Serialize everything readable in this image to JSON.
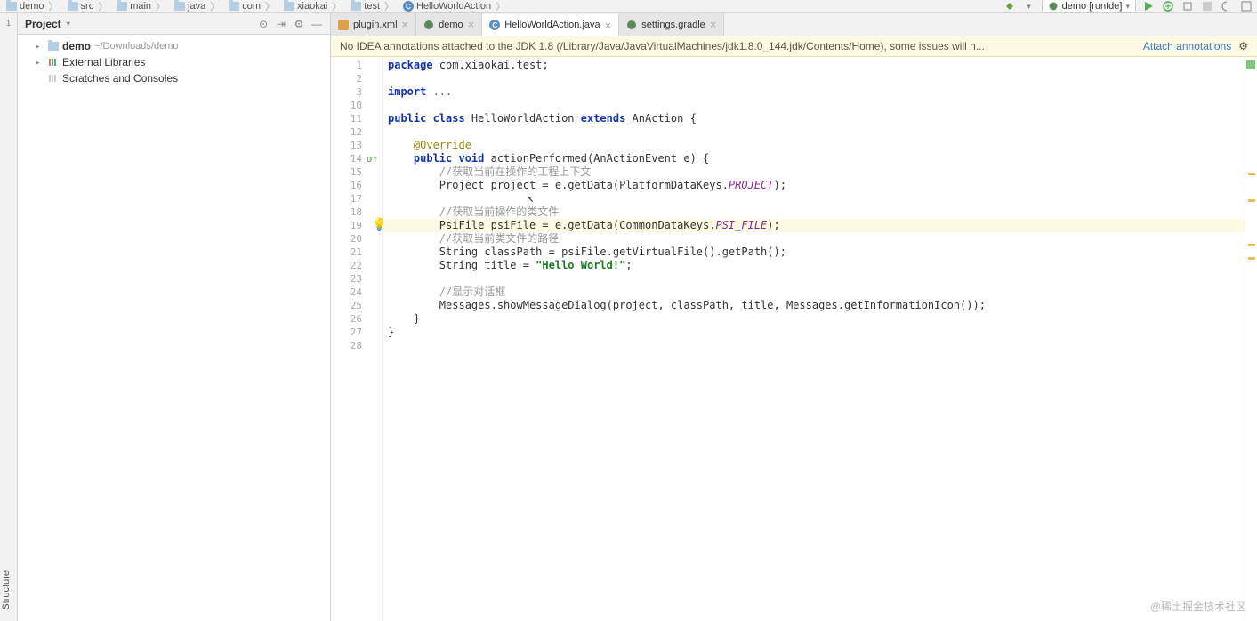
{
  "breadcrumbs": [
    "demo",
    "src",
    "main",
    "java",
    "com",
    "xiaokai",
    "test",
    "HelloWorldAction"
  ],
  "run_config": "demo [runIde]",
  "project_panel": {
    "title": "Project",
    "items": [
      {
        "label": "demo",
        "path": "~/Downloads/demo"
      },
      {
        "label": "External Libraries"
      },
      {
        "label": "Scratches and Consoles"
      }
    ]
  },
  "tabs": [
    {
      "label": "plugin.xml",
      "icon": "xml"
    },
    {
      "label": "demo",
      "icon": "gradle"
    },
    {
      "label": "HelloWorldAction.java",
      "icon": "java",
      "active": true
    },
    {
      "label": "settings.gradle",
      "icon": "gradle"
    }
  ],
  "notification": {
    "message": "No IDEA annotations attached to the JDK 1.8 (/Library/Java/JavaVirtualMachines/jdk1.8.0_144.jdk/Contents/Home), some issues will n...",
    "link": "Attach annotations"
  },
  "code": {
    "start_line": 1,
    "lines": [
      {
        "n": 1,
        "segs": [
          {
            "t": "package ",
            "c": "kw"
          },
          {
            "t": "com.xiaokai.test;"
          }
        ]
      },
      {
        "n": 2,
        "segs": []
      },
      {
        "n": 3,
        "segs": [
          {
            "t": "import ",
            "c": "kw"
          },
          {
            "t": "...",
            "c": "import-fold"
          }
        ]
      },
      {
        "n": 10,
        "segs": []
      },
      {
        "n": 11,
        "segs": [
          {
            "t": "public class ",
            "c": "kw"
          },
          {
            "t": "HelloWorldAction "
          },
          {
            "t": "extends ",
            "c": "kw"
          },
          {
            "t": "AnAction {"
          }
        ]
      },
      {
        "n": 12,
        "segs": []
      },
      {
        "n": 13,
        "segs": [
          {
            "t": "    "
          },
          {
            "t": "@Override",
            "c": "ann"
          }
        ]
      },
      {
        "n": 14,
        "mark": "override",
        "segs": [
          {
            "t": "    "
          },
          {
            "t": "public void ",
            "c": "kw"
          },
          {
            "t": "actionPerformed(AnActionEvent e) {"
          }
        ]
      },
      {
        "n": 15,
        "segs": [
          {
            "t": "        "
          },
          {
            "t": "//获取当前在操作的工程上下文",
            "c": "cmt"
          }
        ]
      },
      {
        "n": 16,
        "segs": [
          {
            "t": "        Project project = e."
          },
          {
            "t": "getData"
          },
          {
            "t": "(PlatformDataKeys."
          },
          {
            "t": "PROJECT",
            "c": "static-field"
          },
          {
            "t": ");"
          }
        ]
      },
      {
        "n": 17,
        "segs": []
      },
      {
        "n": 18,
        "segs": [
          {
            "t": "        "
          },
          {
            "t": "//获取当前操作的类文件",
            "c": "cmt"
          }
        ]
      },
      {
        "n": 19,
        "current": true,
        "mark": "bulb",
        "segs": [
          {
            "t": "        PsiFile psiFile = e."
          },
          {
            "t": "getData"
          },
          {
            "t": "(CommonDataKeys."
          },
          {
            "t": "PSI_FILE",
            "c": "static-field"
          },
          {
            "t": ");"
          }
        ]
      },
      {
        "n": 20,
        "segs": [
          {
            "t": "        "
          },
          {
            "t": "//获取当前类文件的路径",
            "c": "cmt"
          }
        ]
      },
      {
        "n": 21,
        "segs": [
          {
            "t": "        String classPath = psiFile."
          },
          {
            "t": "getVirtualFile"
          },
          {
            "t": "().getPath();"
          }
        ]
      },
      {
        "n": 22,
        "segs": [
          {
            "t": "        String title = "
          },
          {
            "t": "\"Hello World!\"",
            "c": "str"
          },
          {
            "t": ";"
          }
        ]
      },
      {
        "n": 23,
        "segs": []
      },
      {
        "n": 24,
        "segs": [
          {
            "t": "        "
          },
          {
            "t": "//显示对话框",
            "c": "cmt"
          }
        ]
      },
      {
        "n": 25,
        "segs": [
          {
            "t": "        Messages."
          },
          {
            "t": "showMessageDialog",
            "c": ""
          },
          {
            "t": "(project, classPath, title, Messages."
          },
          {
            "t": "getInformationIcon",
            "c": ""
          },
          {
            "t": "());"
          }
        ]
      },
      {
        "n": 26,
        "segs": [
          {
            "t": "    }"
          }
        ]
      },
      {
        "n": 27,
        "segs": [
          {
            "t": "}"
          }
        ]
      },
      {
        "n": 28,
        "segs": []
      }
    ]
  },
  "side_strip": {
    "structure": "Structure"
  },
  "watermark": "@稀土掘金技术社区"
}
